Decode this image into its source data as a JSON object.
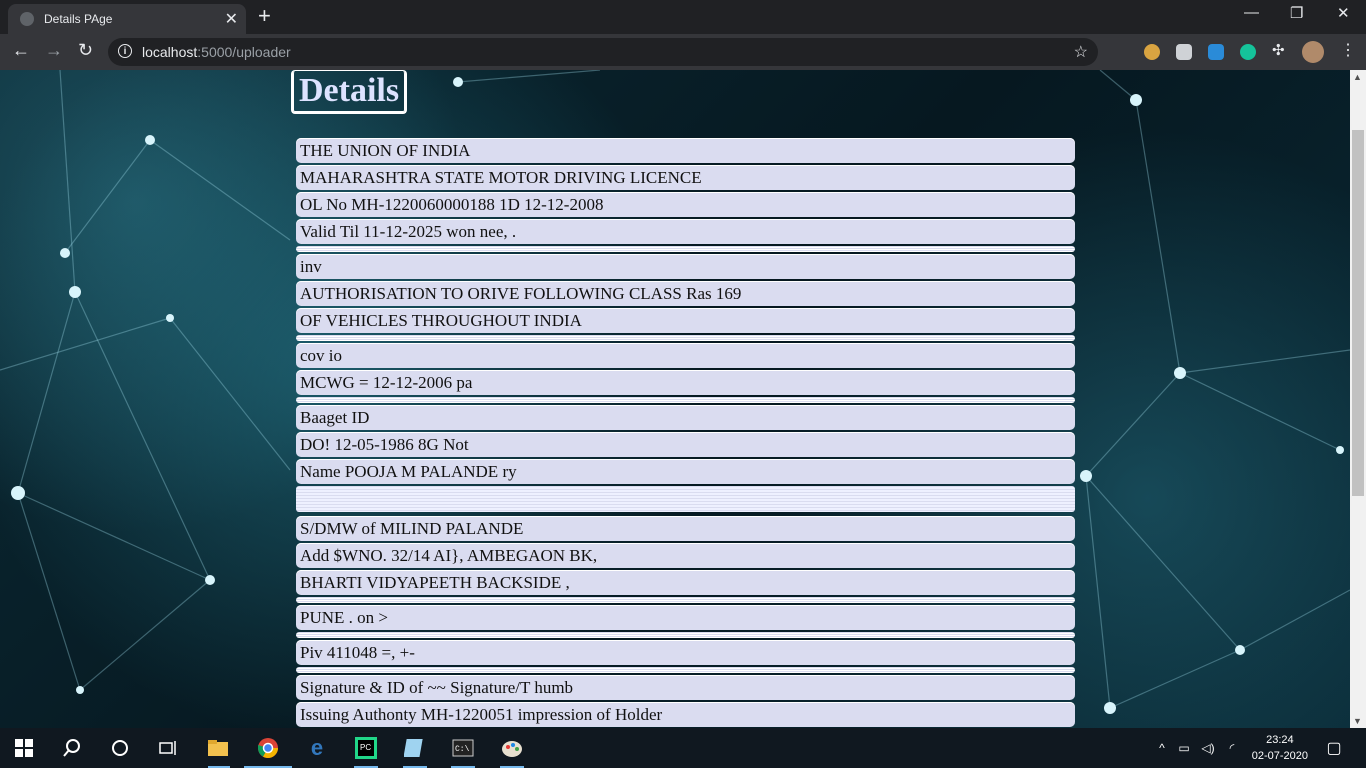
{
  "browser": {
    "tab_title": "Details PAge",
    "url_host": "localhost",
    "url_path": ":5000/uploader"
  },
  "page": {
    "heading": "Details",
    "lines": [
      {
        "text": "THE UNION OF INDIA",
        "gap_after": false
      },
      {
        "text": "MAHARASHTRA STATE MOTOR DRIVING LICENCE",
        "gap_after": false
      },
      {
        "text": "OL No MH-1220060000188 1D 12-12-2008",
        "gap_after": false
      },
      {
        "text": "Valid Til 11-12-2025 won nee, .",
        "gap_after": true
      },
      {
        "text": "inv",
        "gap_after": false
      },
      {
        "text": "AUTHORISATION TO ORIVE FOLLOWING CLASS Ras 169",
        "gap_after": false
      },
      {
        "text": "OF VEHICLES THROUGHOUT INDIA",
        "gap_after": true
      },
      {
        "text": "cov io",
        "gap_after": false
      },
      {
        "text": "MCWG = 12-12-2006 pa",
        "gap_after": true
      },
      {
        "text": "Baaget ID",
        "gap_after": false
      },
      {
        "text": "DO! 12-05-1986 8G Not",
        "gap_after": false
      },
      {
        "text": "Name POOJA M PALANDE ry",
        "gap_after": "big"
      },
      {
        "text": "S/DMW of MILIND PALANDE",
        "gap_after": false
      },
      {
        "text": "Add $WNO. 32/14 AI}, AMBEGAON BK,",
        "gap_after": false
      },
      {
        "text": "BHARTI VIDYAPEETH BACKSIDE ,",
        "gap_after": true
      },
      {
        "text": "PUNE . on >",
        "gap_after": true
      },
      {
        "text": "Piv 411048 =, +-",
        "gap_after": true
      },
      {
        "text": "Signature & ID of ~~ Signature/T humb",
        "gap_after": false
      },
      {
        "text": "Issuing Authonty MH-1220051 impression of Holder",
        "gap_after": false
      }
    ]
  },
  "taskbar": {
    "time": "23:24",
    "date": "02-07-2020"
  },
  "colors": {
    "row_bg": "#dadcf0",
    "heading_text": "#dde3ff"
  }
}
